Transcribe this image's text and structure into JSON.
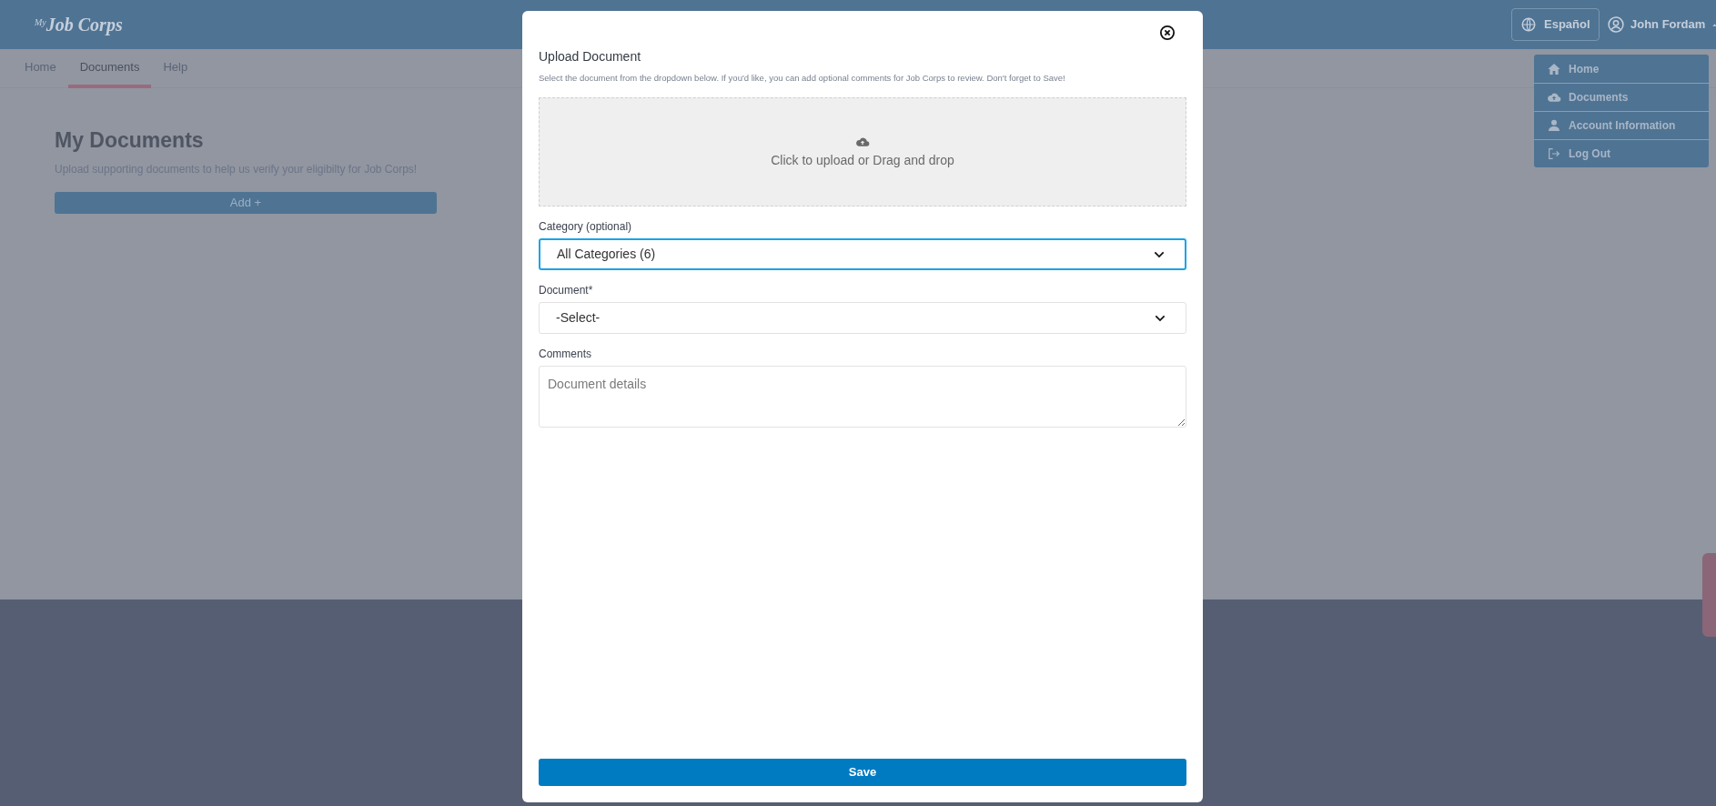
{
  "header": {
    "logo": {
      "prefix": "My",
      "name": "Job Corps"
    },
    "language_button": "Español",
    "user_name": "John Fordam"
  },
  "tabs": [
    {
      "label": "Home",
      "selected": false
    },
    {
      "label": "Documents",
      "selected": true
    },
    {
      "label": "Help",
      "selected": false
    }
  ],
  "page": {
    "title": "My Documents",
    "subtitle": "Upload supporting documents to help us verify your eligibilty for Job Corps!",
    "add_button": "Add +"
  },
  "user_menu": {
    "expanded": true,
    "items": [
      {
        "label": "Home",
        "kind": "home"
      },
      {
        "label": "Documents",
        "kind": "documents"
      },
      {
        "label": "Account Information",
        "kind": "account"
      },
      {
        "label": "Log Out",
        "kind": "logout"
      }
    ]
  },
  "dialog": {
    "title": "Upload Document",
    "description": "Select the document from the dropdown below. If you'd like, you can add optional comments for Job Corps to review. Don't forget to Save!",
    "dropzone": "Click to upload or Drag and drop",
    "fields": [
      {
        "label": "Category (optional)",
        "kind": "select",
        "value": "All Categories (6)",
        "focused": true
      },
      {
        "label": "Document*",
        "kind": "select",
        "value": "-Select-",
        "focused": false
      },
      {
        "label": "Comments",
        "kind": "textarea",
        "placeholder": "Document details",
        "focused": false
      }
    ],
    "save_button": "Save"
  }
}
